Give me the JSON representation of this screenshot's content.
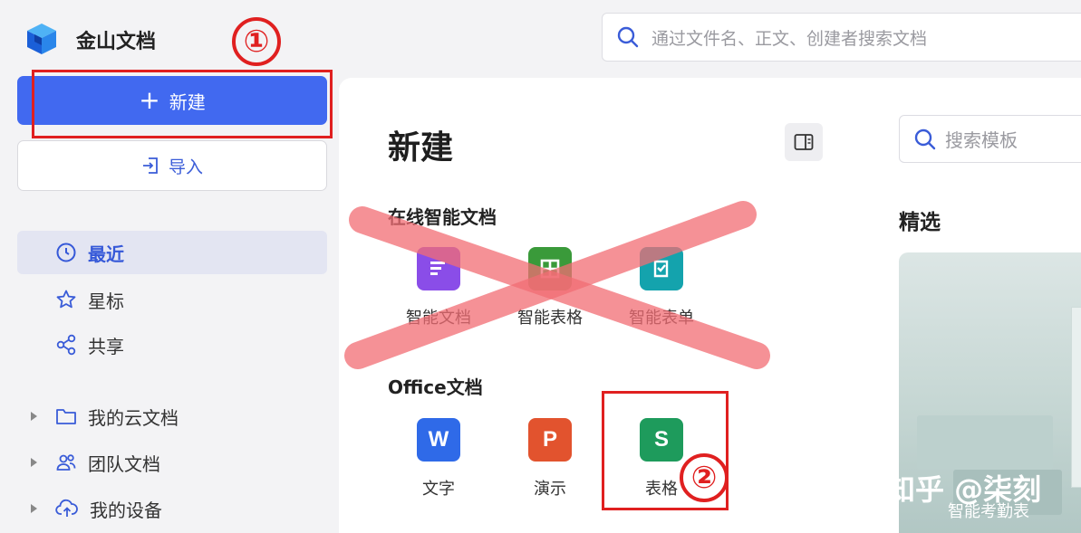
{
  "app": {
    "title": "金山文档",
    "logo_icon": "wps-cube-logo"
  },
  "search": {
    "placeholder": "通过文件名、正文、创建者搜索文档"
  },
  "sidebar": {
    "new_label": "新建",
    "import_label": "导入",
    "nav": [
      {
        "label": "最近",
        "icon": "clock-icon",
        "active": true
      },
      {
        "label": "星标",
        "icon": "star-icon",
        "active": false
      },
      {
        "label": "共享",
        "icon": "share-icon",
        "active": false
      }
    ],
    "tree": [
      {
        "label": "我的云文档",
        "icon": "folder-icon"
      },
      {
        "label": "团队文档",
        "icon": "team-icon"
      },
      {
        "label": "我的设备",
        "icon": "cloud-upload-icon"
      }
    ]
  },
  "panel": {
    "title": "新建",
    "template_search_placeholder": "搜索模板",
    "featured_label": "精选",
    "featured_card_caption": "智能考勤表",
    "sections": {
      "smart": {
        "label": "在线智能文档",
        "items": [
          {
            "label": "智能文档",
            "color": "#8a4de8"
          },
          {
            "label": "智能表格",
            "color": "#3a9a3a"
          },
          {
            "label": "智能表单",
            "color": "#14a3ad"
          }
        ]
      },
      "office": {
        "label": "Office文档",
        "items": [
          {
            "label": "文字",
            "glyph": "W",
            "color": "#2f6ae8"
          },
          {
            "label": "演示",
            "glyph": "P",
            "color": "#e2532e"
          },
          {
            "label": "表格",
            "glyph": "S",
            "color": "#1e9b5c"
          }
        ]
      }
    }
  },
  "annotations": {
    "step1": "①",
    "step2": "②",
    "accent": "#e02020"
  },
  "watermark": "知乎 @柒刻"
}
